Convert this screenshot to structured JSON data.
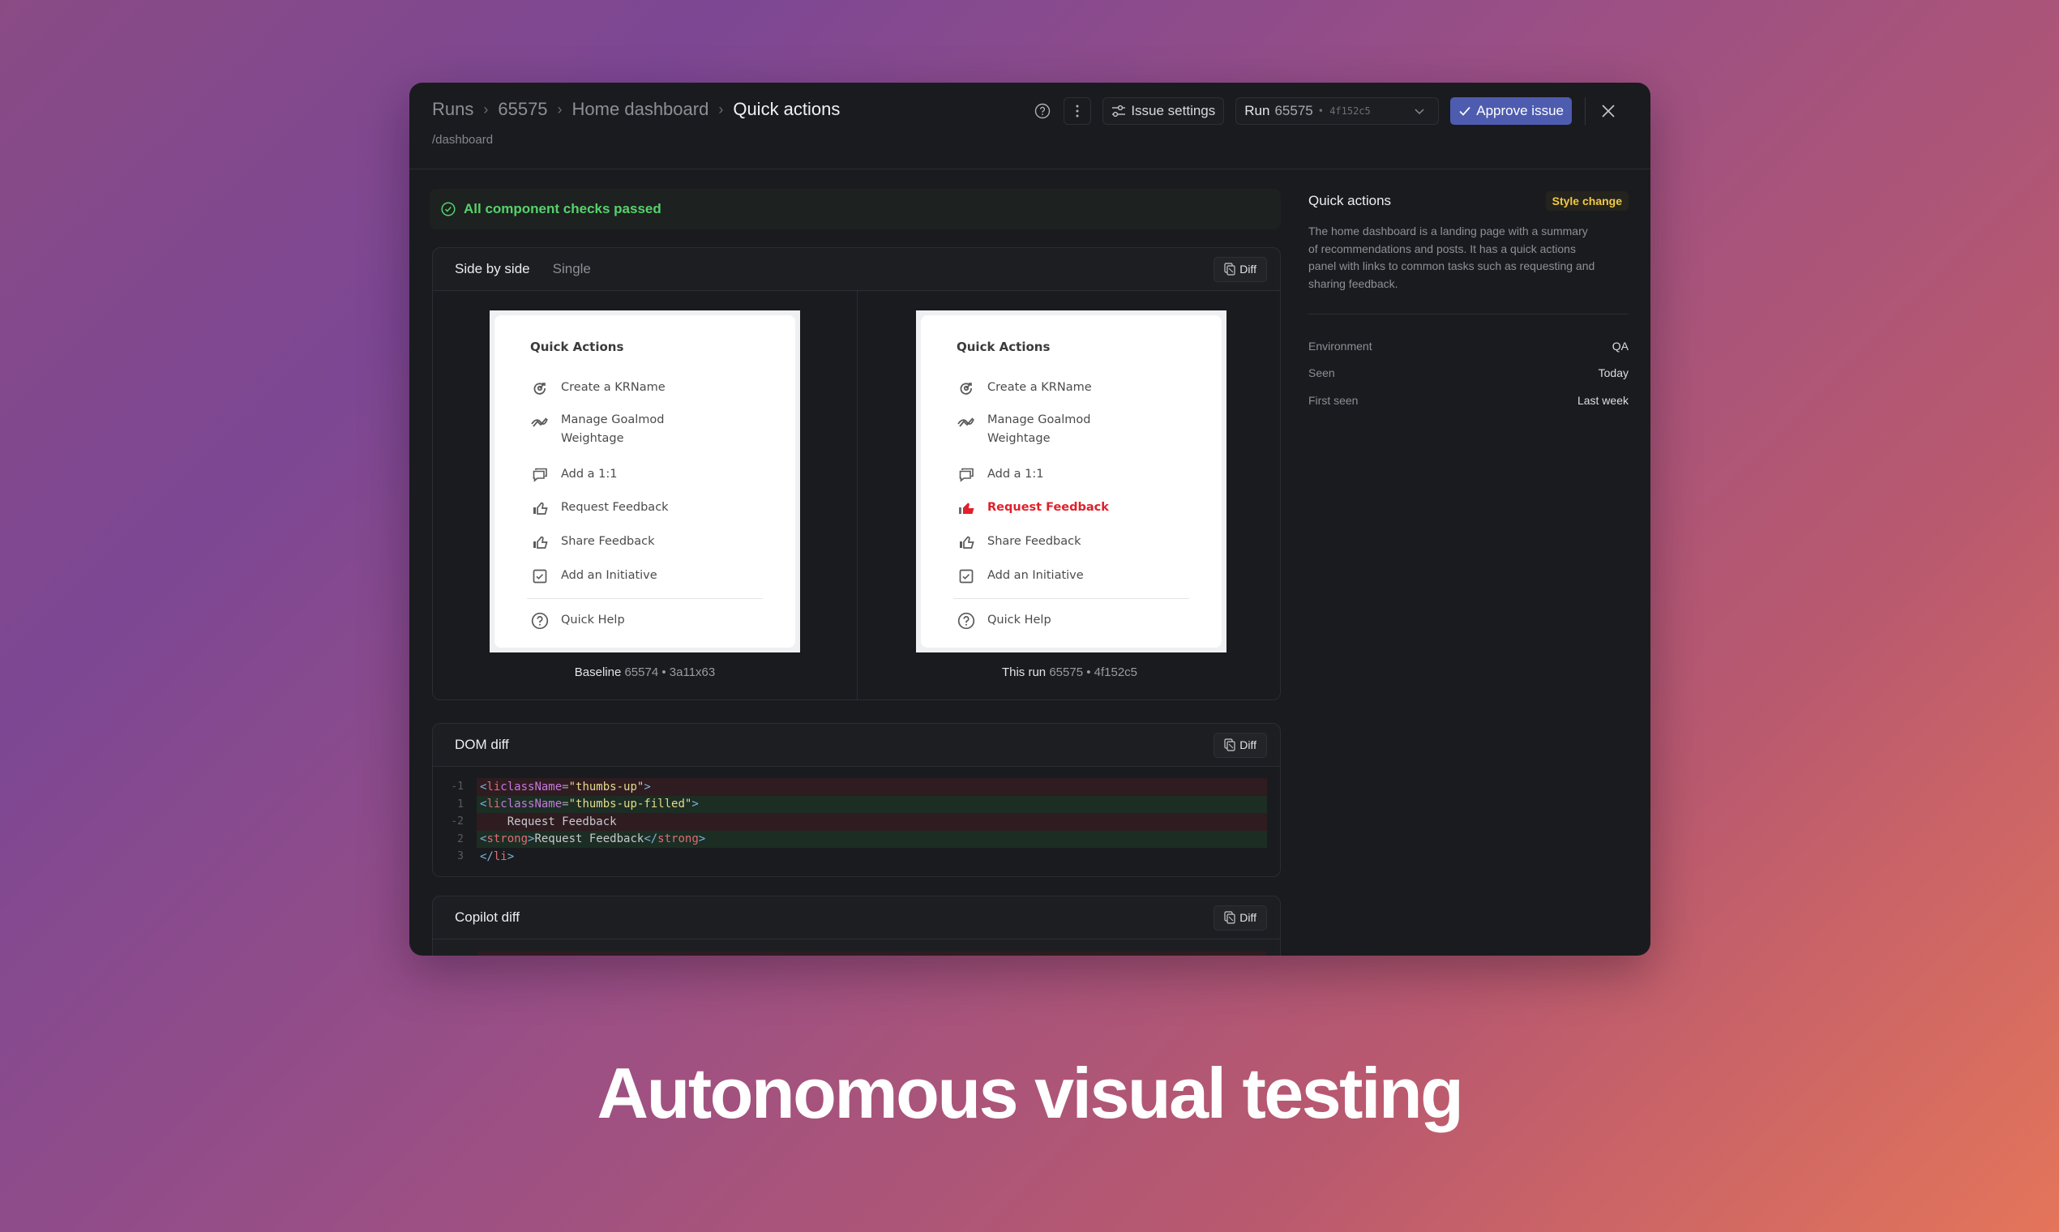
{
  "header": {
    "breadcrumbs": [
      "Runs",
      "65575",
      "Home dashboard",
      "Quick actions"
    ],
    "path": "/dashboard",
    "help_icon": "help-circle-icon",
    "more_icon": "more-vertical-icon",
    "issue_settings_label": "Issue settings",
    "run_selector": {
      "label": "Run",
      "number": "65575",
      "hash": "4f152c5"
    },
    "approve_label": "Approve issue",
    "close_icon": "close-icon"
  },
  "banner": {
    "text": "All component checks passed",
    "color": "#55d26a"
  },
  "compare": {
    "tabs": [
      "Side by side",
      "Single"
    ],
    "active_tab": "Side by side",
    "diff_label": "Diff",
    "widget": {
      "title": "Quick Actions",
      "items": [
        {
          "icon": "target-icon",
          "label": "Create a KRName"
        },
        {
          "icon": "trend-icon",
          "label": "Manage Goalmod Weightage"
        },
        {
          "icon": "chat-icon",
          "label": "Add a 1:1"
        },
        {
          "icon": "thumbs-up-icon",
          "label": "Request Feedback"
        },
        {
          "icon": "thumbs-up-icon",
          "label": "Share Feedback"
        },
        {
          "icon": "checkbox-icon",
          "label": "Add an Initiative"
        },
        {
          "icon": "help-circle-icon",
          "label": "Quick Help"
        }
      ],
      "changed_item": "Request Feedback",
      "changed_color": "#e0202a"
    },
    "baseline": {
      "label": "Baseline",
      "run": "65574",
      "hash": "3a11x63"
    },
    "this_run": {
      "label": "This run",
      "run": "65575",
      "hash": "4f152c5"
    }
  },
  "dom_diff": {
    "title": "DOM diff",
    "diff_label": "Diff",
    "lines": [
      {
        "num": "-1",
        "type": "del",
        "text": "<li className=\"thumbs-up\">"
      },
      {
        "num": "1",
        "type": "add",
        "text": "<li className=\"thumbs-up-filled\">"
      },
      {
        "num": "-2",
        "type": "del",
        "text": "    Request Feedback"
      },
      {
        "num": "2",
        "type": "add",
        "text": "    <strong>Request Feedback</strong>"
      },
      {
        "num": "3",
        "type": "ctx",
        "text": "</li>"
      }
    ]
  },
  "copilot_diff": {
    "title": "Copilot diff",
    "diff_label": "Diff"
  },
  "side": {
    "title": "Quick actions",
    "badge": "Style change",
    "badge_color": "#f0c945",
    "description": "The home dashboard is a landing page with a summary of recommendations and posts. It has a quick actions panel with links to common tasks such as requesting and sharing feedback.",
    "meta": [
      {
        "key": "Environment",
        "value": "QA"
      },
      {
        "key": "Seen",
        "value": "Today"
      },
      {
        "key": "First seen",
        "value": "Last week"
      }
    ]
  },
  "headline": "Autonomous visual testing"
}
